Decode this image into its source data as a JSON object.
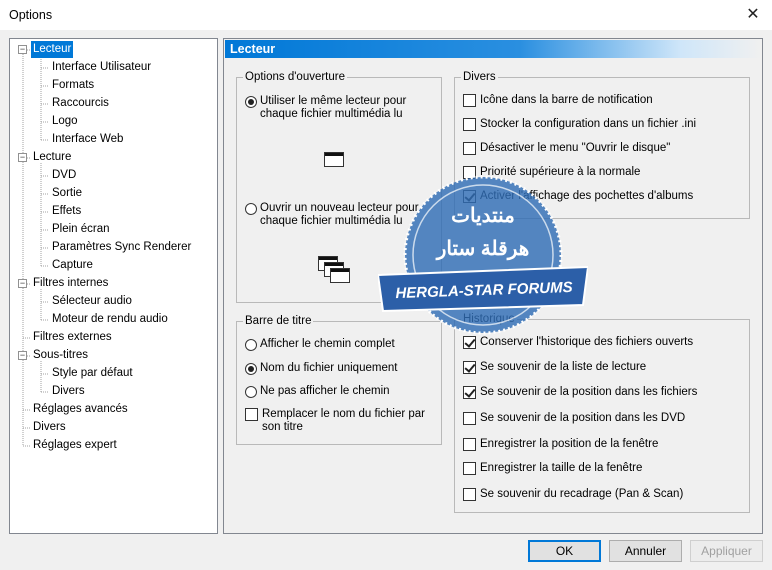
{
  "window": {
    "title": "Options",
    "close_glyph": "✕"
  },
  "tree": {
    "items": [
      {
        "label": "Lecteur",
        "level": 0,
        "expander": "−",
        "selected": true
      },
      {
        "label": "Interface Utilisateur",
        "level": 1
      },
      {
        "label": "Formats",
        "level": 1
      },
      {
        "label": "Raccourcis",
        "level": 1
      },
      {
        "label": "Logo",
        "level": 1
      },
      {
        "label": "Interface Web",
        "level": 1
      },
      {
        "label": "Lecture",
        "level": 0,
        "expander": "−"
      },
      {
        "label": "DVD",
        "level": 1
      },
      {
        "label": "Sortie",
        "level": 1
      },
      {
        "label": "Effets",
        "level": 1
      },
      {
        "label": "Plein écran",
        "level": 1
      },
      {
        "label": "Paramètres Sync Renderer",
        "level": 1
      },
      {
        "label": "Capture",
        "level": 1
      },
      {
        "label": "Filtres internes",
        "level": 0,
        "expander": "−"
      },
      {
        "label": "Sélecteur audio",
        "level": 1
      },
      {
        "label": "Moteur de rendu audio",
        "level": 1
      },
      {
        "label": "Filtres externes",
        "level": 0
      },
      {
        "label": "Sous-titres",
        "level": 0,
        "expander": "−"
      },
      {
        "label": "Style par défaut",
        "level": 1
      },
      {
        "label": "Divers",
        "level": 1
      },
      {
        "label": "Réglages avancés",
        "level": 0
      },
      {
        "label": "Divers",
        "level": 0
      },
      {
        "label": "Réglages expert",
        "level": 0
      }
    ]
  },
  "panel": {
    "header": "Lecteur",
    "open_options": {
      "legend": "Options d'ouverture",
      "same_player": {
        "label": "Utiliser le même lecteur pour chaque fichier multimédia lu",
        "checked": true
      },
      "new_player": {
        "label": "Ouvrir un nouveau lecteur pour chaque fichier multimédia lu",
        "checked": false
      }
    },
    "titlebar_group": {
      "legend": "Barre de titre",
      "full_path": {
        "label": "Afficher le chemin complet",
        "checked": false
      },
      "file_name_only": {
        "label": "Nom du fichier uniquement",
        "checked": true
      },
      "no_path": {
        "label": "Ne pas afficher le chemin",
        "checked": false
      },
      "replace_name": {
        "label": "Remplacer le nom du fichier par son titre",
        "checked": false
      }
    },
    "misc": {
      "legend": "Divers",
      "items": [
        {
          "label": "Icône dans la barre de notification",
          "checked": false
        },
        {
          "label": "Stocker la configuration dans un fichier .ini",
          "checked": false
        },
        {
          "label": "Désactiver le menu \"Ouvrir le disque\"",
          "checked": false
        },
        {
          "label": "Priorité supérieure à la normale",
          "checked": false
        },
        {
          "label": "Activer l'affichage des pochettes d'albums",
          "checked": true
        }
      ]
    },
    "history": {
      "legend": "Historique",
      "items": [
        {
          "label": "Conserver l'historique des fichiers ouverts",
          "checked": true
        },
        {
          "label": "Se souvenir de la liste de lecture",
          "checked": true
        },
        {
          "label": "Se souvenir de la position dans les fichiers",
          "checked": true
        },
        {
          "label": "Se souvenir de la position dans les DVD",
          "checked": false
        },
        {
          "label": "Enregistrer la position de la fenêtre",
          "checked": false
        },
        {
          "label": "Enregistrer la taille de la fenêtre",
          "checked": false
        },
        {
          "label": "Se souvenir du recadrage (Pan & Scan)",
          "checked": false
        }
      ]
    }
  },
  "buttons": {
    "ok": "OK",
    "cancel": "Annuler",
    "apply": "Appliquer"
  },
  "watermark": {
    "arabic_line1": "منتديات",
    "arabic_line2": "هرقلة ستار",
    "banner": "HERGLA-STAR FORUMS"
  },
  "colors": {
    "accent": "#0078d7",
    "watermark_blue": "#2f6db5"
  }
}
